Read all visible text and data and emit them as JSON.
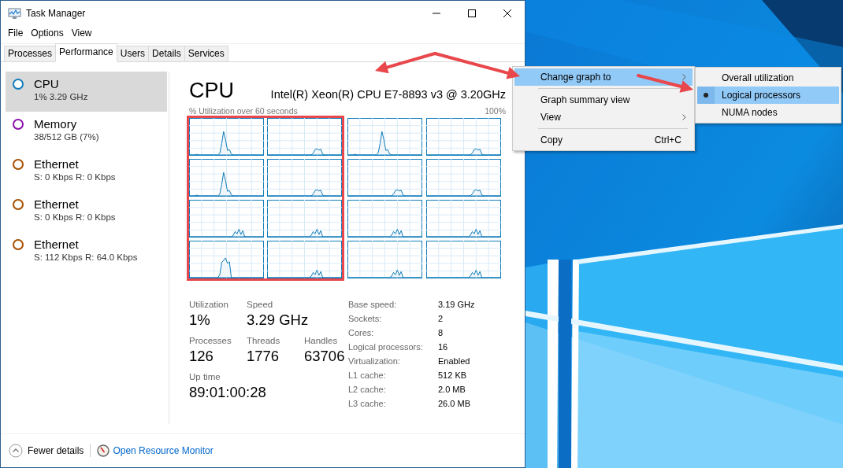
{
  "window": {
    "title": "Task Manager"
  },
  "menu_bar": [
    "File",
    "Options",
    "View"
  ],
  "tabs": [
    {
      "label": "Processes",
      "selected": false
    },
    {
      "label": "Performance",
      "selected": true
    },
    {
      "label": "Users",
      "selected": false
    },
    {
      "label": "Details",
      "selected": false
    },
    {
      "label": "Services",
      "selected": false
    }
  ],
  "sidebar": {
    "items": [
      {
        "name": "CPU",
        "detail": "1%  3.29 GHz",
        "color": "#117dbb",
        "selected": true
      },
      {
        "name": "Memory",
        "detail": "38/512 GB (7%)",
        "color": "#8b12ae",
        "selected": false
      },
      {
        "name": "Ethernet",
        "detail": "S: 0 Kbps R: 0 Kbps",
        "color": "#a74f01",
        "selected": false
      },
      {
        "name": "Ethernet",
        "detail": "S: 0 Kbps R: 0 Kbps",
        "color": "#a74f01",
        "selected": false
      },
      {
        "name": "Ethernet",
        "detail": "S: 112 Kbps R: 64.0 Kbps",
        "color": "#a74f01",
        "selected": false
      }
    ]
  },
  "cpu_panel": {
    "title": "CPU",
    "model": "Intel(R) Xeon(R) CPU E7-8893 v3 @ 3.20GHz",
    "graph_caption": "% Utilization over 60 seconds",
    "graph_max": "100%",
    "graph_columns": [
      {
        "highlighted": true,
        "graphs": [
          {
            "kind": "spike"
          },
          {
            "kind": "spike"
          },
          {
            "kind": "twin"
          },
          {
            "kind": "block"
          }
        ]
      },
      {
        "highlighted": true,
        "graphs": [
          {
            "kind": "plateau"
          },
          {
            "kind": "plateau"
          },
          {
            "kind": "twin"
          },
          {
            "kind": "twin"
          }
        ]
      },
      {
        "highlighted": false,
        "graphs": [
          {
            "kind": "spike"
          },
          {
            "kind": "plateau"
          },
          {
            "kind": "twin"
          },
          {
            "kind": "twin"
          }
        ]
      },
      {
        "highlighted": false,
        "graphs": [
          {
            "kind": "plateau"
          },
          {
            "kind": "plateau"
          },
          {
            "kind": "twin"
          },
          {
            "kind": "twin"
          }
        ]
      }
    ],
    "stats": [
      [
        {
          "label": "Utilization",
          "value": "1%"
        },
        {
          "label": "Speed",
          "value": "3.29 GHz"
        }
      ],
      [
        {
          "label": "Processes",
          "value": "126"
        },
        {
          "label": "Threads",
          "value": "1776"
        },
        {
          "label": "Handles",
          "value": "63706"
        }
      ],
      [
        {
          "label": "Up time",
          "value": "89:01:00:28"
        }
      ]
    ],
    "details": [
      {
        "label": "Base speed:",
        "value": "3.19 GHz"
      },
      {
        "label": "Sockets:",
        "value": "2"
      },
      {
        "label": "Cores:",
        "value": "8"
      },
      {
        "label": "Logical processors:",
        "value": "16"
      },
      {
        "label": "Virtualization:",
        "value": "Enabled"
      },
      {
        "label": "L1 cache:",
        "value": "512 KB"
      },
      {
        "label": "L2 cache:",
        "value": "2.0 MB"
      },
      {
        "label": "L3 cache:",
        "value": "26.0 MB"
      }
    ]
  },
  "footer": {
    "fewer_details": "Fewer details",
    "resource_monitor_link": "Open Resource Monitor"
  },
  "context_menu": {
    "items": [
      {
        "kind": "submenu",
        "label": "Change graph to",
        "highlighted": true
      },
      {
        "kind": "separator"
      },
      {
        "kind": "item",
        "label": "Graph summary view",
        "highlighted": false
      },
      {
        "kind": "submenu",
        "label": "View",
        "highlighted": false
      },
      {
        "kind": "separator"
      },
      {
        "kind": "item",
        "label": "Copy",
        "shortcut": "Ctrl+C",
        "highlighted": false
      }
    ]
  },
  "submenu": {
    "items": [
      {
        "label": "Overall utilization",
        "selected": false
      },
      {
        "label": "Logical processors",
        "selected": true
      },
      {
        "label": "NUMA nodes",
        "selected": false
      }
    ]
  }
}
